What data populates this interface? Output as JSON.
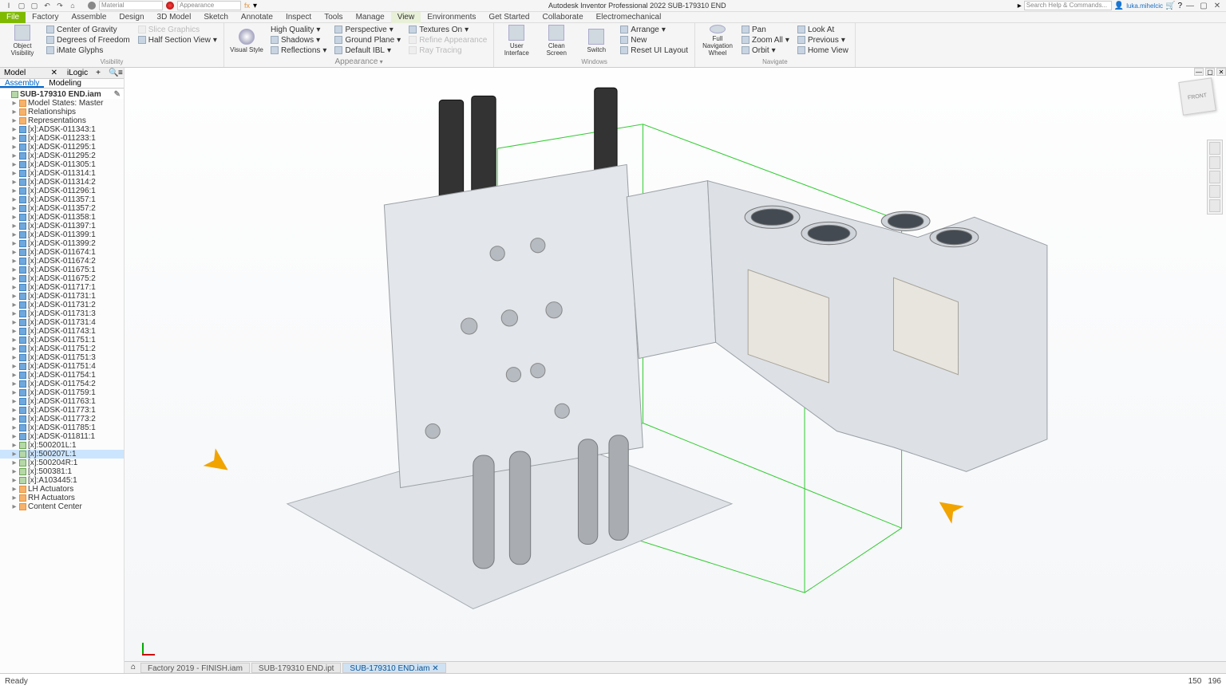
{
  "app_title": "Autodesk Inventor Professional 2022   SUB-179310 END",
  "search_placeholder": "Search Help & Commands...",
  "user_name": "luka.mihelcic",
  "qat_material": "Material",
  "qat_appearance": "Appearance",
  "ribbon_tabs": [
    "File",
    "Factory",
    "Assemble",
    "Design",
    "3D Model",
    "Sketch",
    "Annotate",
    "Inspect",
    "Tools",
    "Manage",
    "View",
    "Environments",
    "Get Started",
    "Collaborate",
    "Electromechanical"
  ],
  "active_tab": "View",
  "ribbon": {
    "visibility": {
      "object_visibility": "Object\nVisibility",
      "center_of_gravity": "Center of Gravity",
      "degrees_of_freedom": "Degrees of Freedom",
      "imate_glyphs": "iMate Glyphs",
      "slice_graphics": "Slice Graphics",
      "half_section": "Half Section View",
      "label": "Visibility"
    },
    "appearance": {
      "visual_style": "Visual Style",
      "high_quality": "High Quality",
      "shadows": "Shadows",
      "reflections": "Reflections",
      "perspective": "Perspective",
      "ground_plane": "Ground Plane",
      "default_ibl": "Default IBL",
      "textures_on": "Textures On",
      "refine": "Refine Appearance",
      "ray_tracing": "Ray Tracing",
      "label": "Appearance"
    },
    "windows": {
      "user_interface": "User\nInterface",
      "clean_screen": "Clean\nScreen",
      "switch": "Switch",
      "arrange": "Arrange",
      "new": "New",
      "reset": "Reset UI Layout",
      "label": "Windows"
    },
    "navigate": {
      "full_wheel": "Full Navigation\nWheel",
      "pan": "Pan",
      "zoom_all": "Zoom All",
      "orbit": "Orbit",
      "look_at": "Look At",
      "previous": "Previous",
      "home_view": "Home View",
      "label": "Navigate"
    }
  },
  "browser": {
    "tab_model": "Model",
    "tab_logic": "iLogic",
    "sub_assembly": "Assembly",
    "sub_modeling": "Modeling",
    "root": "SUB-179310 END.iam",
    "model_states": "Model States: Master",
    "relationships": "Relationships",
    "representations": "Representations",
    "parts": [
      "ADSK-011343:1",
      "ADSK-011233:1",
      "ADSK-011295:1",
      "ADSK-011295:2",
      "ADSK-011305:1",
      "ADSK-011314:1",
      "ADSK-011314:2",
      "ADSK-011296:1",
      "ADSK-011357:1",
      "ADSK-011357:2",
      "ADSK-011358:1",
      "ADSK-011397:1",
      "ADSK-011399:1",
      "ADSK-011399:2",
      "ADSK-011674:1",
      "ADSK-011674:2",
      "ADSK-011675:1",
      "ADSK-011675:2",
      "ADSK-011717:1",
      "ADSK-011731:1",
      "ADSK-011731:2",
      "ADSK-011731:3",
      "ADSK-011731:4",
      "ADSK-011743:1",
      "ADSK-011751:1",
      "ADSK-011751:2",
      "ADSK-011751:3",
      "ADSK-011751:4",
      "ADSK-011754:1",
      "ADSK-011754:2",
      "ADSK-011759:1",
      "ADSK-011763:1",
      "ADSK-011773:1",
      "ADSK-011773:2",
      "ADSK-011785:1",
      "ADSK-011811:1"
    ],
    "subs": [
      "500201L:1",
      "500207L:1",
      "500204R:1",
      "500381:1",
      "A103445:1"
    ],
    "lh": "LH Actuators",
    "rh": "RH Actuators",
    "cc": "Content Center"
  },
  "file_tabs": [
    "Factory 2019 - FINISH.iam",
    "SUB-179310 END.ipt",
    "SUB-179310 END.iam"
  ],
  "status_text": "Ready",
  "status_coords": {
    "a": "150",
    "b": "196"
  },
  "viewcube": "FRONT"
}
